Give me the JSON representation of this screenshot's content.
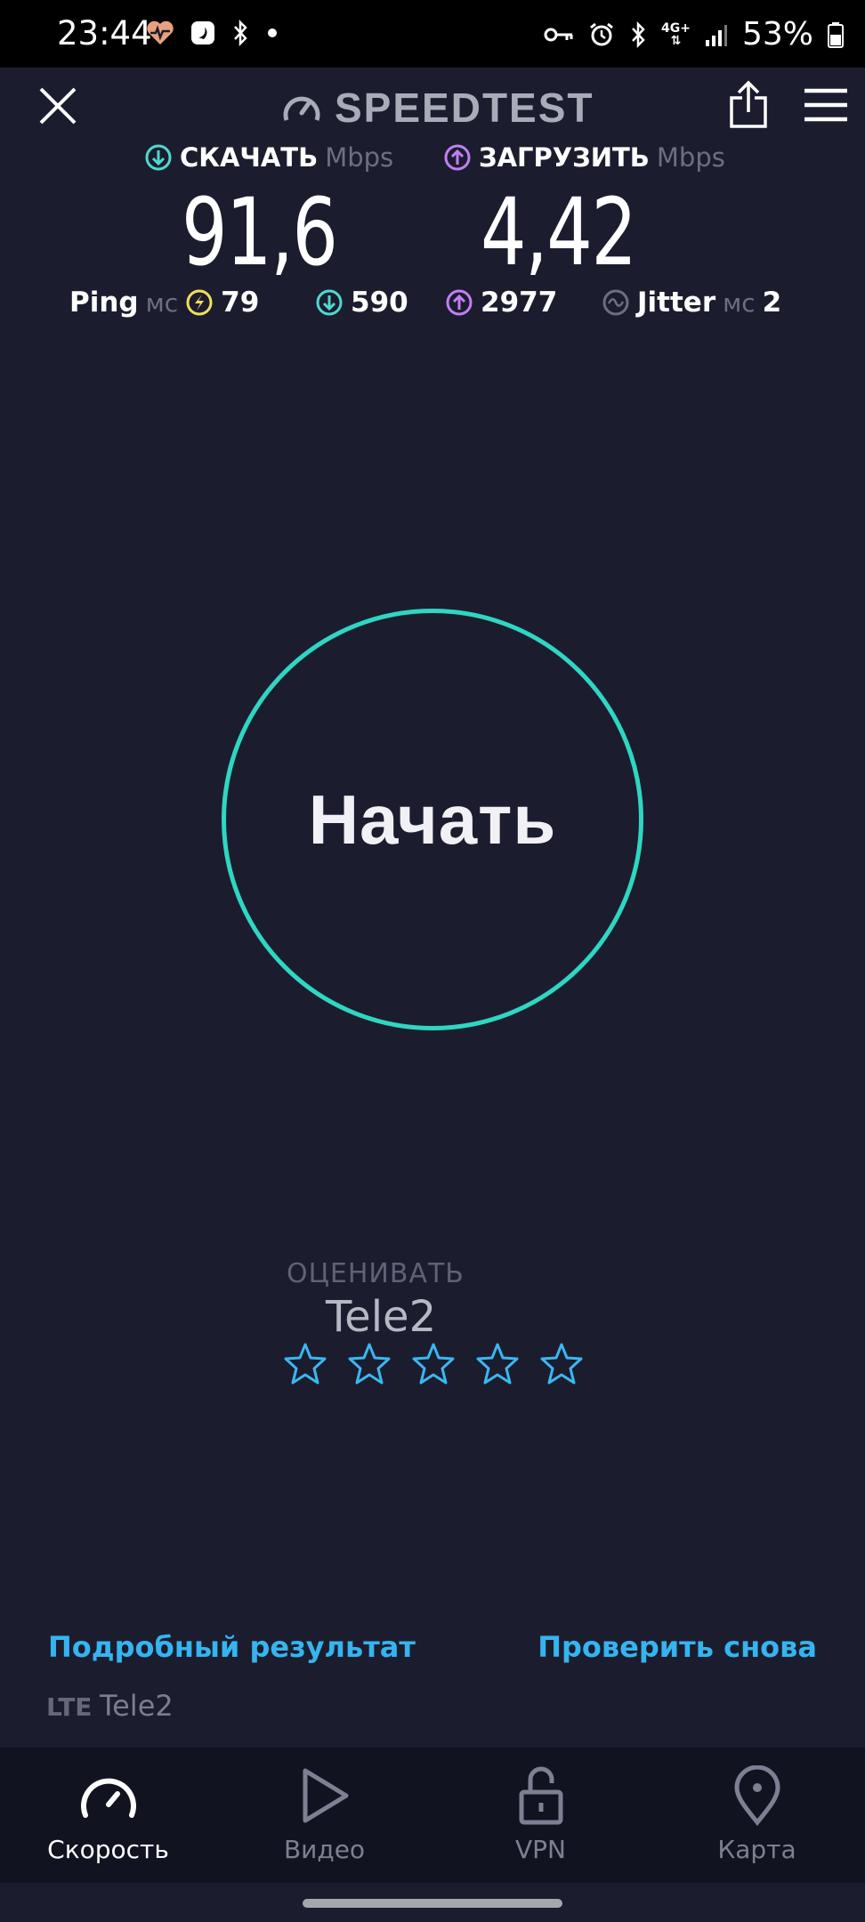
{
  "status_bar": {
    "time": "23:44",
    "battery": "53%",
    "network": "4G+",
    "icons": [
      "heart-health-icon",
      "surfshark-icon",
      "bluetooth-icon",
      "dot-icon",
      "vpn-key-icon",
      "alarm-icon",
      "bluetooth-icon",
      "mobile-data-icon",
      "signal-icon",
      "battery-icon"
    ]
  },
  "header": {
    "logo_text": "SPEEDTEST",
    "icons": [
      "close-icon",
      "speedometer-logo-icon",
      "share-icon",
      "menu-icon"
    ]
  },
  "results": {
    "download_label": "СКАЧАТЬ",
    "download_unit": "Mbps",
    "download_value": "91,6",
    "upload_label": "ЗАГРУЗИТЬ",
    "upload_unit": "Mbps",
    "upload_value": "4,42",
    "ping_label": "Ping",
    "ping_unit": "мс",
    "ping_idle": "79",
    "ping_download": "590",
    "ping_upload": "2977",
    "jitter_label": "Jitter",
    "jitter_unit": "мс",
    "jitter_value": "2"
  },
  "go_button": {
    "label": "Начать"
  },
  "rating": {
    "caption": "ОЦЕНИВАТЬ",
    "provider": "Tele2",
    "stars_total": 5,
    "stars_selected": 0
  },
  "links": {
    "details": "Подробный результат",
    "retest": "Проверить снова"
  },
  "connection": {
    "type": "LTE",
    "provider": "Tele2"
  },
  "bottom_nav": {
    "items": [
      {
        "label": "Скорость",
        "icon": "speed-icon",
        "active": true
      },
      {
        "label": "Видео",
        "icon": "play-icon",
        "active": false
      },
      {
        "label": "VPN",
        "icon": "lock-icon",
        "active": false
      },
      {
        "label": "Карта",
        "icon": "map-pin-icon",
        "active": false
      }
    ]
  },
  "colors": {
    "background": "#1b1d2f",
    "accent_teal": "#2fd6c2",
    "download": "#4fd8d0",
    "upload": "#c27ff2",
    "ping": "#f2df5a",
    "link": "#35b4ef",
    "star": "#3bb7f0"
  }
}
